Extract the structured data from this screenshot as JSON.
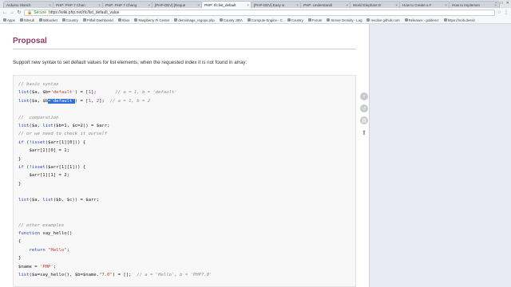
{
  "tabs": [
    {
      "label": "Arduino Sketch",
      "active": false
    },
    {
      "label": "PHP: PHP 7 Chan",
      "active": false
    },
    {
      "label": "PHP: PHP 7 Chang",
      "active": false
    },
    {
      "label": "[PHP-DEV] [Reque",
      "active": false
    },
    {
      "label": "PHP: rfc:list_default",
      "active": true
    },
    {
      "label": "[PHP-DEV] Easy w",
      "active": false
    },
    {
      "label": "PHP: Understandi",
      "active": false
    },
    {
      "label": "World Elephant D",
      "active": false
    },
    {
      "label": "How to Create a F",
      "active": false
    },
    {
      "label": "How to Implemen",
      "active": false
    }
  ],
  "window_controls": [
    "–",
    "□",
    "✕"
  ],
  "address": {
    "secure_label": "Secure",
    "url": "https://wiki.php.net/rfc/list_default_value"
  },
  "bookmarks": [
    "Apps",
    "GitHub",
    "Bitbucket",
    "Country",
    "Pitfall Dashboard",
    "Xbox",
    "Raspberry Pi Center",
    "dennimage_regopo.php",
    "County JIRA",
    "Compute Engine - C",
    "Country",
    "Forum",
    "Server Density - Log",
    "resolve github.com",
    "Releases · goldencr",
    "https://mob.densit"
  ],
  "page": {
    "title": "Proposal",
    "intro": "Support new syntax to set default values for list elements, when the requested index it is not found in array:"
  },
  "code_lines": [
    [
      {
        "c": "cm",
        "t": "// basic syntax"
      }
    ],
    [
      {
        "c": "kw",
        "t": "list"
      },
      {
        "c": "",
        "t": "($a, $b="
      },
      {
        "c": "str",
        "t": "'default'"
      },
      {
        "c": "",
        "t": ") = ["
      },
      {
        "c": "num",
        "t": "1"
      },
      {
        "c": "",
        "t": "];       "
      },
      {
        "c": "cm",
        "t": "// a = 1, b = 'default'"
      }
    ],
    [
      {
        "c": "kw",
        "t": "list"
      },
      {
        "c": "",
        "t": "($a, $b"
      },
      {
        "c": "hl",
        "t": "='default'"
      },
      {
        "c": "",
        "t": ") = ["
      },
      {
        "c": "num",
        "t": "1"
      },
      {
        "c": "",
        "t": ", "
      },
      {
        "c": "num",
        "t": "2"
      },
      {
        "c": "",
        "t": "];  "
      },
      {
        "c": "cm",
        "t": "// a = 1, b = 2"
      }
    ],
    [
      {
        "c": "",
        "t": ""
      }
    ],
    [
      {
        "c": "cm",
        "t": "//  comparation"
      }
    ],
    [
      {
        "c": "kw",
        "t": "list"
      },
      {
        "c": "",
        "t": "($a, "
      },
      {
        "c": "kw",
        "t": "list"
      },
      {
        "c": "",
        "t": "($b=1, $c=2)) = $arr;"
      }
    ],
    [
      {
        "c": "cm",
        "t": "// or we need to check it ourself"
      }
    ],
    [
      {
        "c": "kw",
        "t": "if"
      },
      {
        "c": "",
        "t": " (!"
      },
      {
        "c": "kw",
        "t": "isset"
      },
      {
        "c": "",
        "t": "($arr[1][0])) {"
      }
    ],
    [
      {
        "c": "",
        "t": "    $arr[1][0] = 1;"
      }
    ],
    [
      {
        "c": "",
        "t": "}"
      }
    ],
    [
      {
        "c": "kw",
        "t": "if"
      },
      {
        "c": "",
        "t": " (!"
      },
      {
        "c": "kw",
        "t": "isset"
      },
      {
        "c": "",
        "t": "($arr[1][1])) {"
      }
    ],
    [
      {
        "c": "",
        "t": "    $arr[1][1] = 2;"
      }
    ],
    [
      {
        "c": "",
        "t": "}"
      }
    ],
    [
      {
        "c": "",
        "t": ""
      }
    ],
    [
      {
        "c": "kw",
        "t": "list"
      },
      {
        "c": "",
        "t": "($a, "
      },
      {
        "c": "kw",
        "t": "list"
      },
      {
        "c": "",
        "t": "($b, $c)) = $arr;"
      }
    ],
    [
      {
        "c": "",
        "t": ""
      }
    ],
    [
      {
        "c": "",
        "t": ""
      }
    ],
    [
      {
        "c": "cm",
        "t": "// other examples"
      }
    ],
    [
      {
        "c": "kw",
        "t": "function"
      },
      {
        "c": "",
        "t": " say_hello()"
      }
    ],
    [
      {
        "c": "",
        "t": "{"
      }
    ],
    [
      {
        "c": "",
        "t": "    "
      },
      {
        "c": "kw",
        "t": "return"
      },
      {
        "c": "",
        "t": " "
      },
      {
        "c": "str",
        "t": "\"Hello\""
      },
      {
        "c": "",
        "t": ";"
      }
    ],
    [
      {
        "c": "",
        "t": "}"
      }
    ],
    [
      {
        "c": "",
        "t": "$name = "
      },
      {
        "c": "str",
        "t": "'PHP'"
      },
      {
        "c": "",
        "t": ";"
      }
    ],
    [
      {
        "c": "kw",
        "t": "list"
      },
      {
        "c": "",
        "t": "($a=say_hello(), $b=$name."
      },
      {
        "c": "str",
        "t": "\"7.0\""
      },
      {
        "c": "",
        "t": ") = [];  "
      },
      {
        "c": "cm",
        "t": "// a = 'Hello', b = 'PHP7.0'"
      }
    ]
  ],
  "side_tools": [
    {
      "name": "search-tool-icon",
      "glyph": "⌕"
    },
    {
      "name": "history-tool-icon",
      "glyph": "↺"
    },
    {
      "name": "link-tool-icon",
      "glyph": "⛓"
    },
    {
      "name": "back-to-top-icon",
      "glyph": "⬆"
    }
  ]
}
